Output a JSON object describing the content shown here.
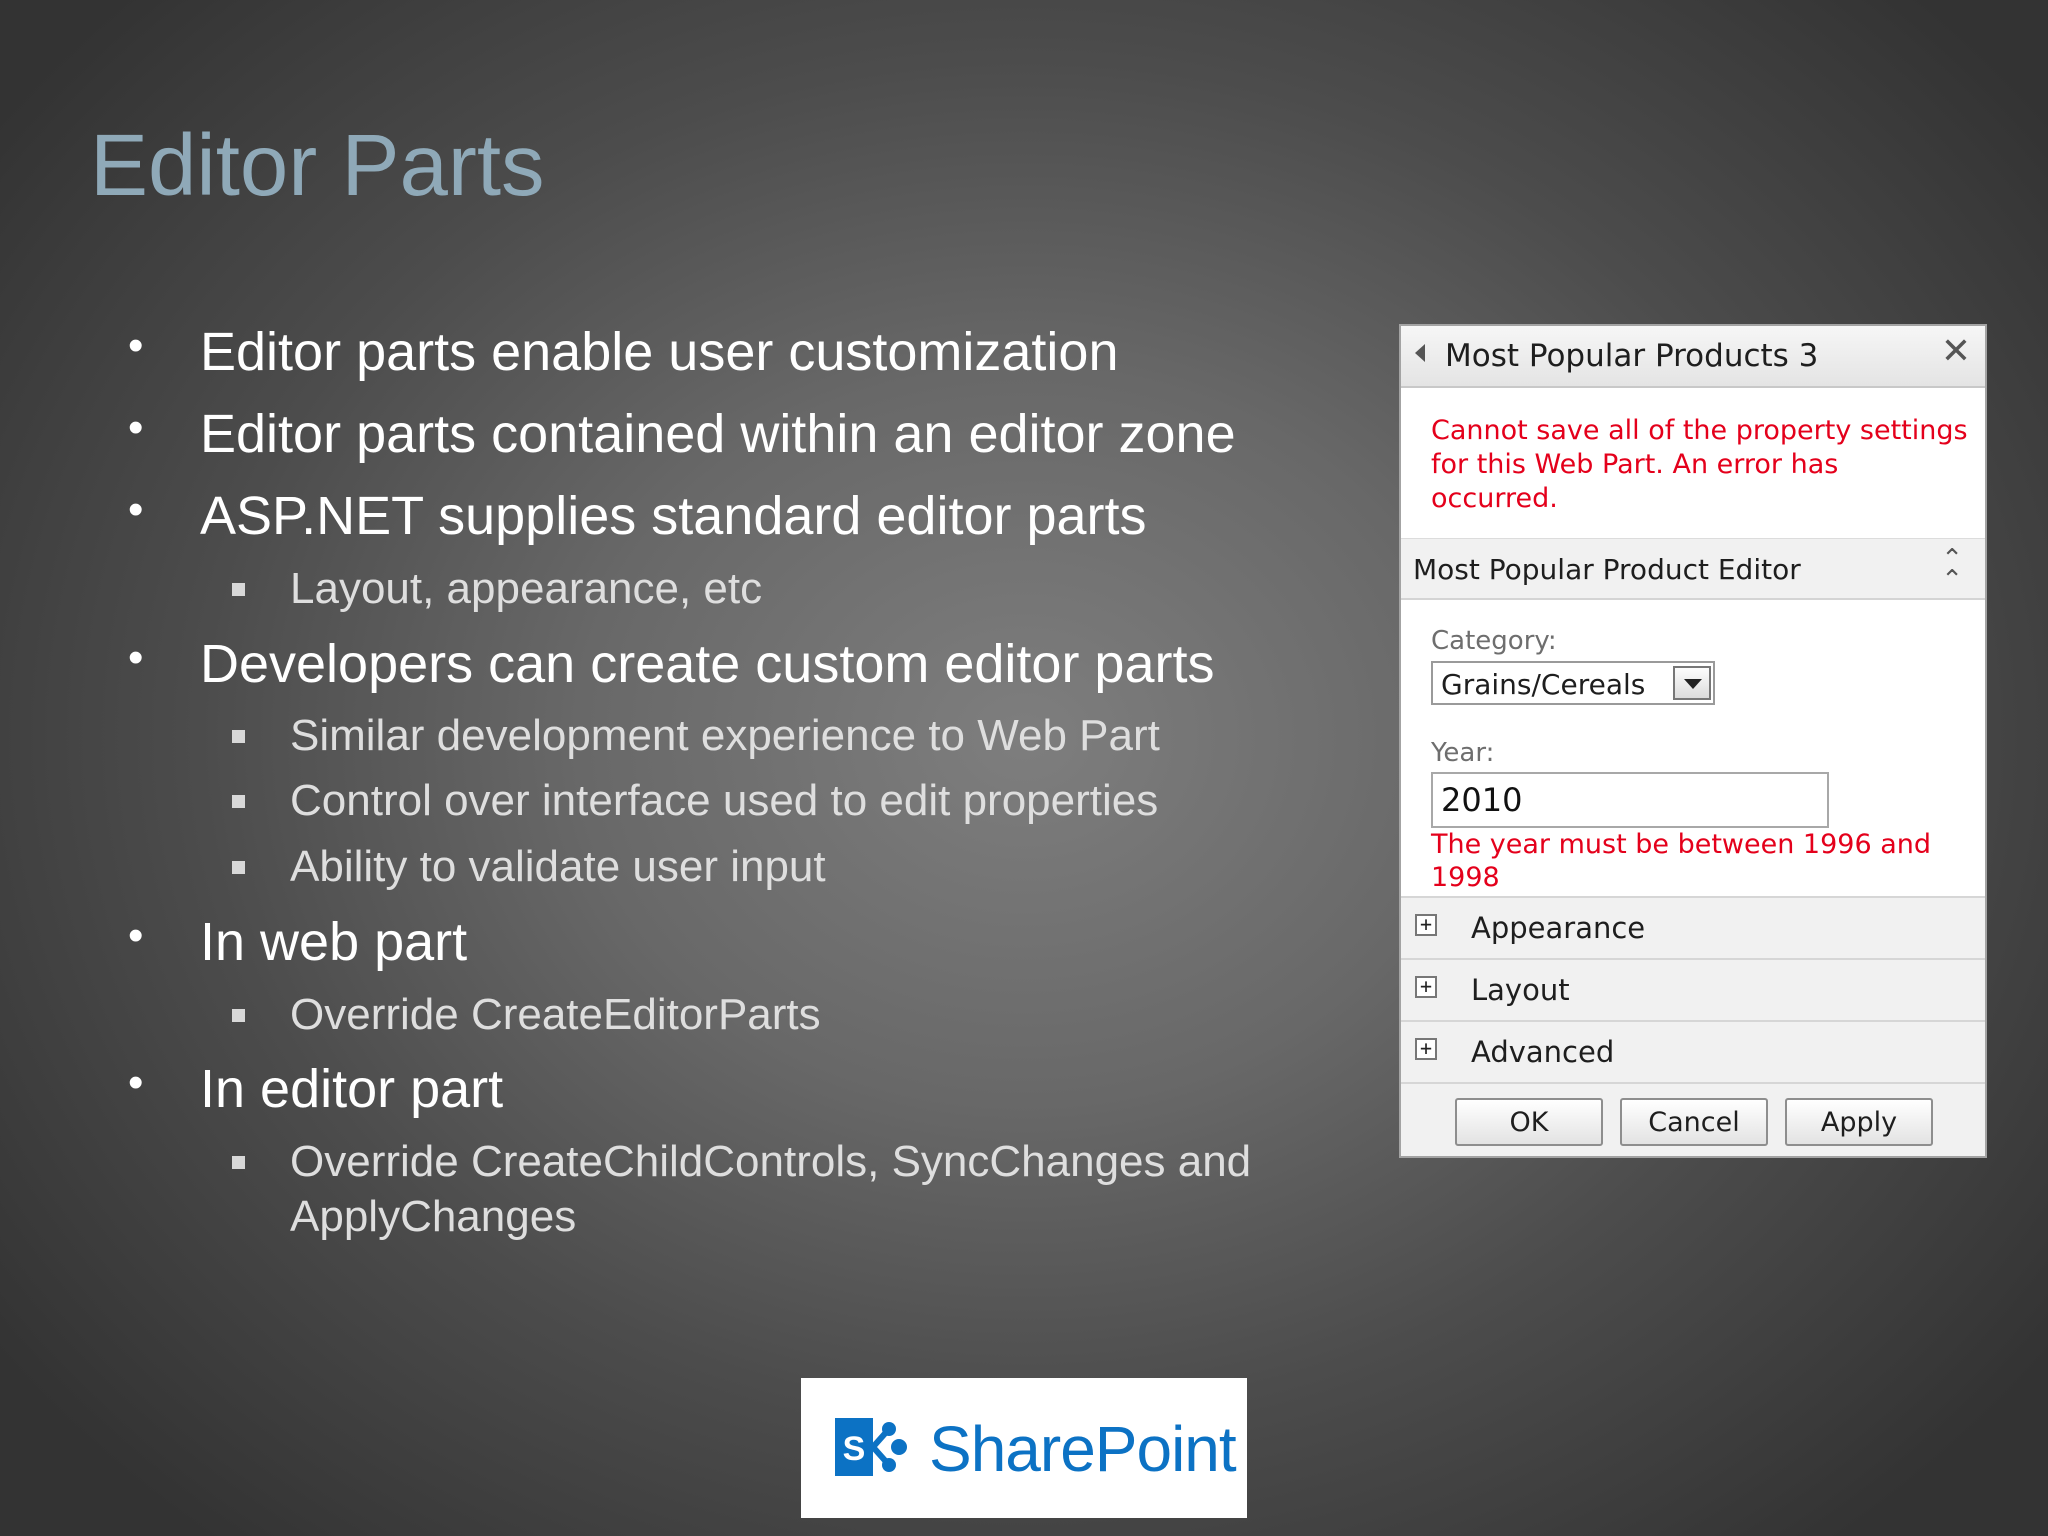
{
  "slide": {
    "title": "Editor Parts",
    "bullets": [
      {
        "text": "Editor parts enable user customization"
      },
      {
        "text": "Editor parts contained within an editor zone"
      },
      {
        "text": "ASP.NET supplies standard editor parts",
        "sub": [
          "Layout, appearance, etc"
        ]
      },
      {
        "text": "Developers can create custom editor parts",
        "sub": [
          "Similar development experience to Web Part",
          "Control over interface used to edit properties",
          "Ability to validate user input"
        ]
      },
      {
        "text": "In web part",
        "sub": [
          "Override CreateEditorParts"
        ]
      },
      {
        "text": "In editor part",
        "sub": [
          "Override CreateChildControls, SyncChanges and",
          "ApplyChanges"
        ]
      }
    ]
  },
  "editor_pane": {
    "title": "Most Popular Products 3",
    "error": "Cannot save all of the property settings for this Web Part. An error has occurred.",
    "section_title": "Most Popular Product Editor",
    "category_label": "Category:",
    "category_value": "Grains/Cereals",
    "year_label": "Year:",
    "year_value": "2010",
    "year_error": "The year must be between 1996 and 1998",
    "groups": [
      "Appearance",
      "Layout",
      "Advanced"
    ],
    "buttons": {
      "ok": "OK",
      "cancel": "Cancel",
      "apply": "Apply"
    }
  },
  "logo": {
    "text": "SharePoint",
    "mark_letter": "S",
    "brand_color": "#0c72c4"
  },
  "colors": {
    "title": "#8fa9b8",
    "error": "#e4001b"
  }
}
